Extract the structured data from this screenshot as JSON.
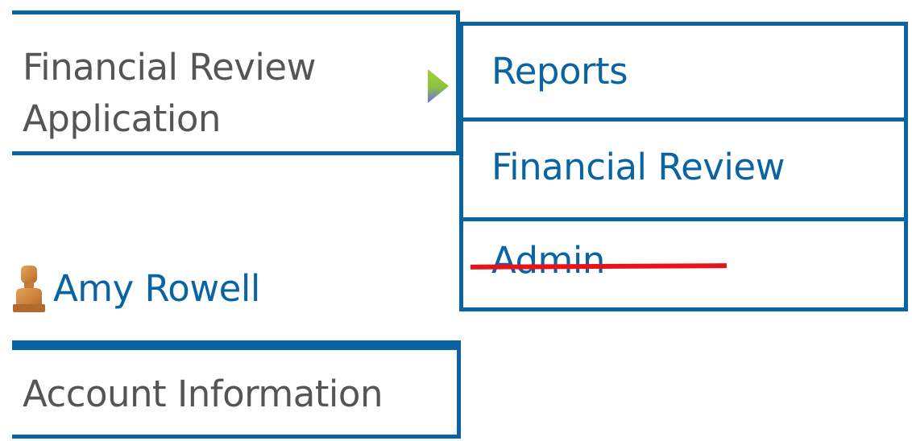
{
  "app_menu": {
    "title_line1": "Financial Review",
    "title_line2": "Application",
    "expand_icon": "play-arrow-icon"
  },
  "submenu": {
    "items": [
      {
        "label": "Reports"
      },
      {
        "label": "Financial Review"
      },
      {
        "label": "Admin",
        "struck_out": true
      }
    ]
  },
  "user": {
    "name": "Amy Rowell",
    "icon": "user-icon"
  },
  "account": {
    "label": "Account Information"
  },
  "colors": {
    "accent": "#0a64a4",
    "text_gray": "#555555",
    "strike": "#e8121a"
  }
}
